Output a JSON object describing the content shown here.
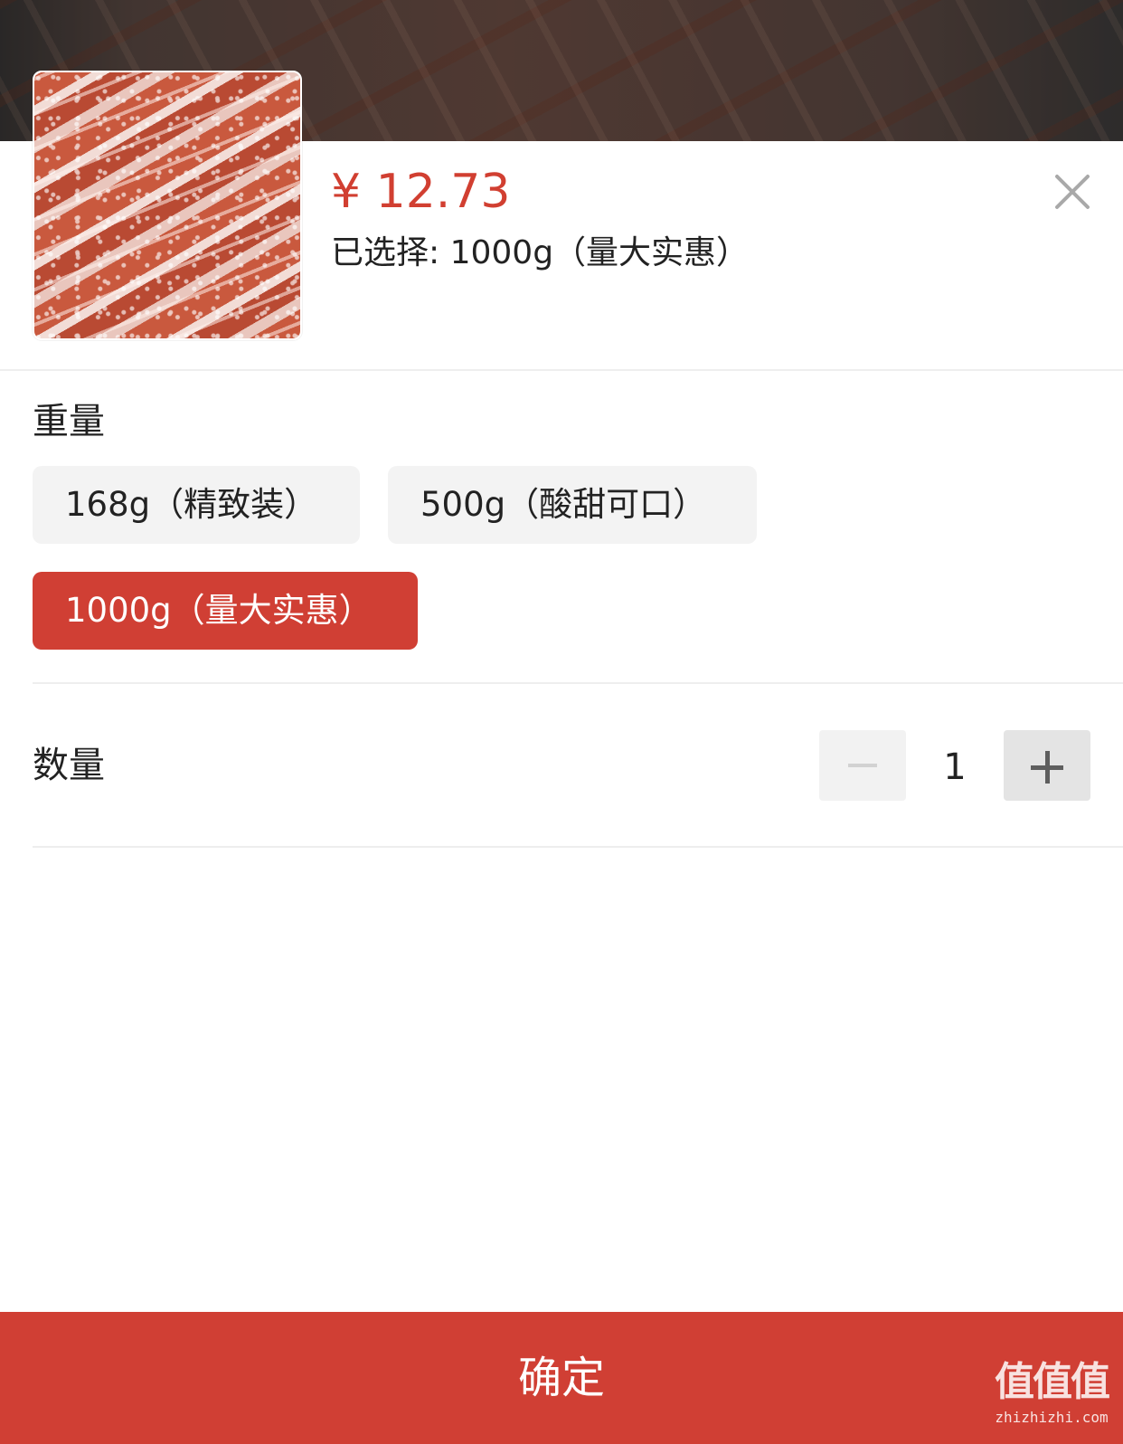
{
  "product": {
    "price": "¥ 12.73",
    "selected": "已选择: 1000g（量大实惠）",
    "image": "candied-fruit-strips-photo"
  },
  "weight_section": {
    "title": "重量",
    "options": [
      {
        "label": "168g（精致装）",
        "selected": false
      },
      {
        "label": "500g（酸甜可口）",
        "selected": false
      },
      {
        "label": "1000g（量大实惠）",
        "selected": true
      }
    ]
  },
  "quantity_section": {
    "title": "数量",
    "value": "1",
    "minus_icon": "minus-icon",
    "plus_icon": "plus-icon"
  },
  "confirm_label": "确定",
  "watermark": {
    "logo": "值值值",
    "url": "zhizhizhi.com"
  },
  "colors": {
    "accent": "#d03f34",
    "price": "#d13f31",
    "option_bg": "#f3f3f3"
  }
}
